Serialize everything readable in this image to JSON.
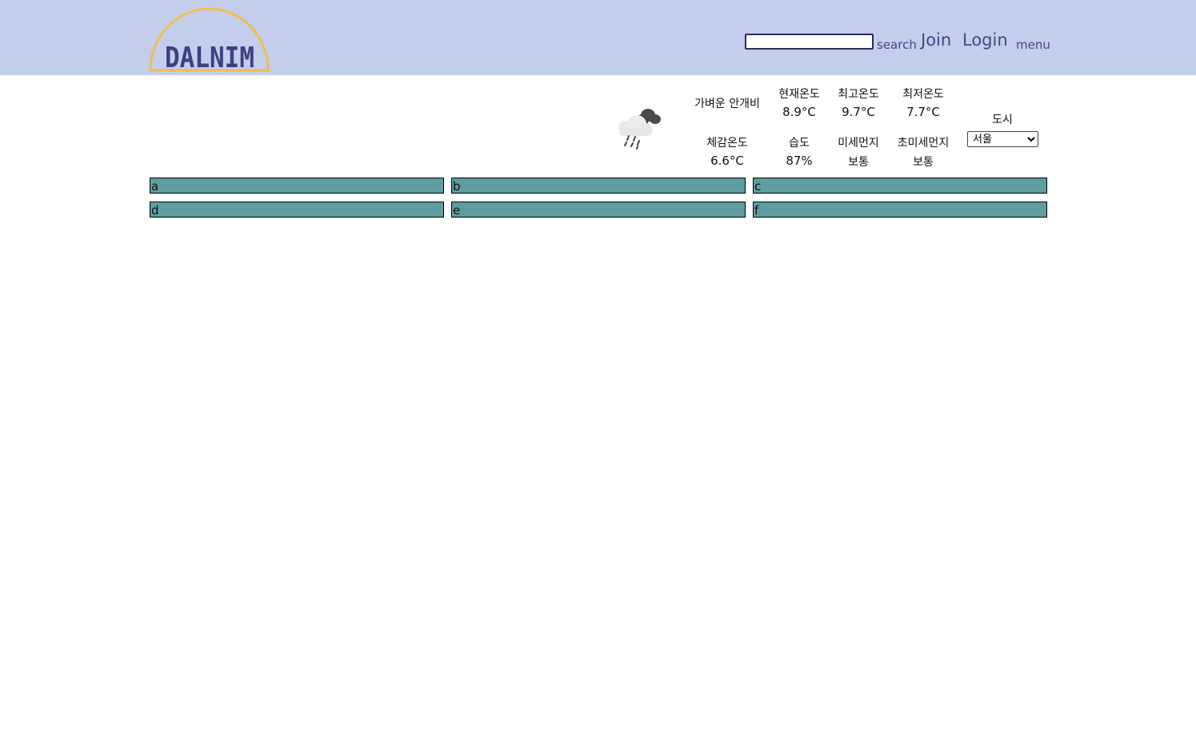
{
  "header": {
    "logo_text": "DALNIM",
    "search_placeholder": "",
    "search_label": "search",
    "join_label": "Join",
    "login_label": "Login",
    "menu_label": "menu"
  },
  "weather": {
    "icon": "cloud-rain-icon",
    "condition": "가벼운 안개비",
    "labels": {
      "current": "현재온도",
      "max": "최고온도",
      "min": "최저온도",
      "feels_like": "체감온도",
      "humidity": "습도",
      "fine_dust": "미세먼지",
      "ultrafine_dust": "초미세먼지",
      "city": "도시"
    },
    "values": {
      "current": "8.9°C",
      "max": "9.7°C",
      "min": "7.7°C",
      "feels_like": "6.6°C",
      "humidity": "87%",
      "fine_dust": "보통",
      "ultrafine_dust": "보통"
    },
    "city_selected": "서울"
  },
  "tiles": [
    "a",
    "b",
    "c",
    "d",
    "e",
    "f"
  ],
  "colors": {
    "header_bg": "#c3cdec",
    "logo_arc": "#f2bd4c",
    "logo_text": "#3b4282",
    "nav_text": "#3e4b86",
    "tile_bg": "#5f9ea0"
  }
}
